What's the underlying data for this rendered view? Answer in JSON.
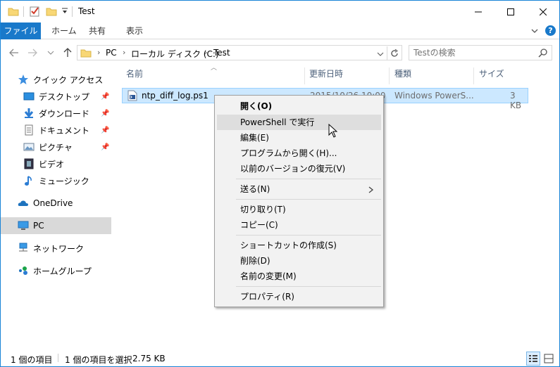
{
  "window": {
    "title": "Test",
    "colors": {
      "accent": "#1979ca",
      "selection": "#cce8ff",
      "hover": "#d9d9d9"
    }
  },
  "ribbon": {
    "tabs": [
      "ファイル",
      "ホーム",
      "共有",
      "表示"
    ]
  },
  "address": {
    "crumbs": [
      "PC",
      "ローカル ディスク (C:)",
      "Test"
    ]
  },
  "search": {
    "placeholder": "Testの検索"
  },
  "sidebar": {
    "quick_access": "クイック アクセス",
    "items": [
      {
        "label": "デスクトップ",
        "icon": "desktop-icon",
        "pinned": true
      },
      {
        "label": "ダウンロード",
        "icon": "download-icon",
        "pinned": true
      },
      {
        "label": "ドキュメント",
        "icon": "document-icon",
        "pinned": true
      },
      {
        "label": "ピクチャ",
        "icon": "picture-icon",
        "pinned": true
      },
      {
        "label": "ビデオ",
        "icon": "video-icon",
        "pinned": false
      },
      {
        "label": "ミュージック",
        "icon": "music-icon",
        "pinned": false
      }
    ],
    "onedrive": "OneDrive",
    "pc": "PC",
    "network": "ネットワーク",
    "homegroup": "ホームグループ"
  },
  "columns": [
    "名前",
    "更新日時",
    "種類",
    "サイズ"
  ],
  "files": [
    {
      "name": "ntp_diff_log.ps1",
      "modified": "2015/10/26 10:00",
      "type": "Windows PowerS...",
      "size": "3 KB"
    }
  ],
  "context_menu": {
    "items": [
      "開く(O)",
      "PowerShell で実行",
      "編集(E)",
      "プログラムから開く(H)...",
      "以前のバージョンの復元(V)",
      "送る(N)",
      "切り取り(T)",
      "コピー(C)",
      "ショートカットの作成(S)",
      "削除(D)",
      "名前の変更(M)",
      "プロパティ(R)"
    ]
  },
  "status": {
    "count": "1 個の項目",
    "selected": "1 個の項目を選択",
    "size": "2.75 KB"
  }
}
